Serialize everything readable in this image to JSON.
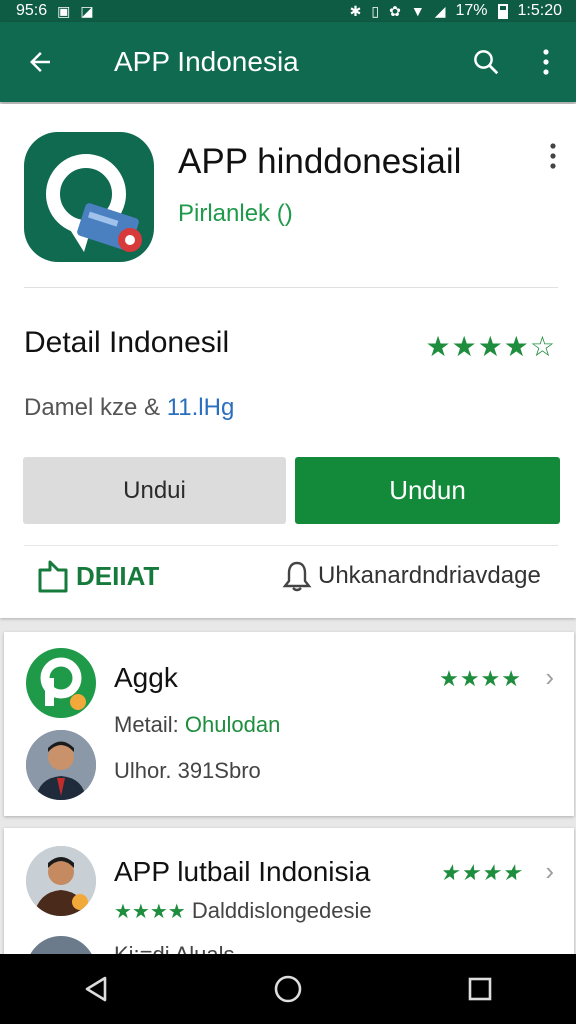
{
  "status_bar": {
    "time_left": "95:6",
    "battery_percent": "17%",
    "clock": "1:5:20"
  },
  "app_bar": {
    "title": "APP Indonesia"
  },
  "app": {
    "name": "APP hinddonesiail",
    "publisher": "Pirlanlek ()",
    "section_title": "Detail Indonesil",
    "rating_stars": "★★★★☆",
    "info_prefix": "Damel kze & ",
    "info_link": "11.lHg",
    "button_secondary": "Undui",
    "button_primary": "Undun",
    "detail_link": "DEIIAT",
    "wishlist": "Uhkanardndriavdage"
  },
  "list": [
    {
      "title": "Aggk",
      "sub_prefix": "Metail: ",
      "sub_highlight": "Ohulodan",
      "sub2": "Ulhor. 391Sbro",
      "stars": "★★★★"
    },
    {
      "title": "APP lutbail Indonisia",
      "stars_left": "★★★★",
      "sub": "Dalddislongedesie",
      "stars": "★★★★",
      "partial_text": "Ki:=di Aluals"
    }
  ],
  "colors": {
    "brand_dark": "#0f6a50",
    "status_bar": "#0f5c45",
    "accent_green": "#138a3a"
  },
  "icons": [
    "back-arrow-icon",
    "search-icon",
    "more-vert-icon",
    "star-icon",
    "bookmark-icon",
    "bell-icon",
    "chevron-right-icon",
    "nav-back-icon",
    "nav-home-icon",
    "nav-recents-icon"
  ]
}
